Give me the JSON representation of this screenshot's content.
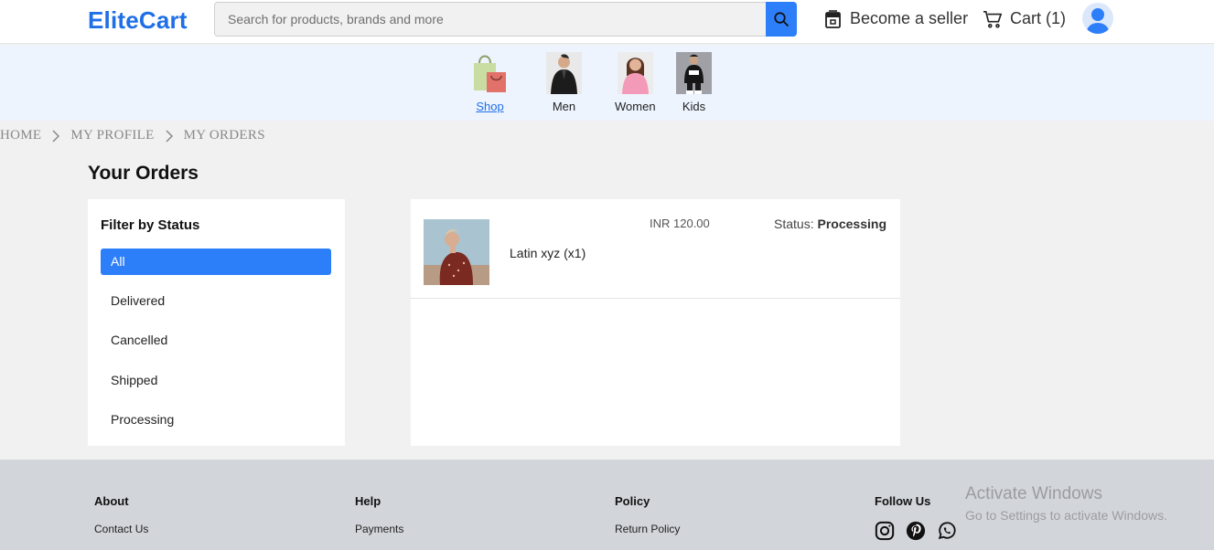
{
  "header": {
    "logo": "EliteCart",
    "search_placeholder": "Search for products, brands and more",
    "seller_label": "Become a seller",
    "cart_label": "Cart (1)"
  },
  "categories": [
    {
      "label": "Shop",
      "active": true
    },
    {
      "label": "Men"
    },
    {
      "label": "Women"
    },
    {
      "label": "Kids"
    }
  ],
  "breadcrumb": [
    "HOME",
    "MY PROFILE",
    "MY ORDERS"
  ],
  "page_title": "Your Orders",
  "filter": {
    "title": "Filter by Status",
    "options": [
      "All",
      "Delivered",
      "Cancelled",
      "Shipped",
      "Processing"
    ],
    "selected": "All"
  },
  "orders": [
    {
      "name": "Latin xyz (x1)",
      "price": "INR 120.00",
      "status_label": "Status:",
      "status": "Processing"
    }
  ],
  "footer": {
    "columns": [
      {
        "title": "About",
        "links": [
          "Contact Us"
        ]
      },
      {
        "title": "Help",
        "links": [
          "Payments"
        ]
      },
      {
        "title": "Policy",
        "links": [
          "Return Policy"
        ]
      },
      {
        "title": "Follow Us",
        "icons": [
          "instagram-icon",
          "pinterest-icon",
          "whatsapp-icon"
        ]
      }
    ]
  },
  "watermark": {
    "line1": "Activate Windows",
    "line2": "Go to Settings to activate Windows."
  },
  "colors": {
    "brand": "#1f6fe6",
    "accent": "#2d7ff9"
  }
}
